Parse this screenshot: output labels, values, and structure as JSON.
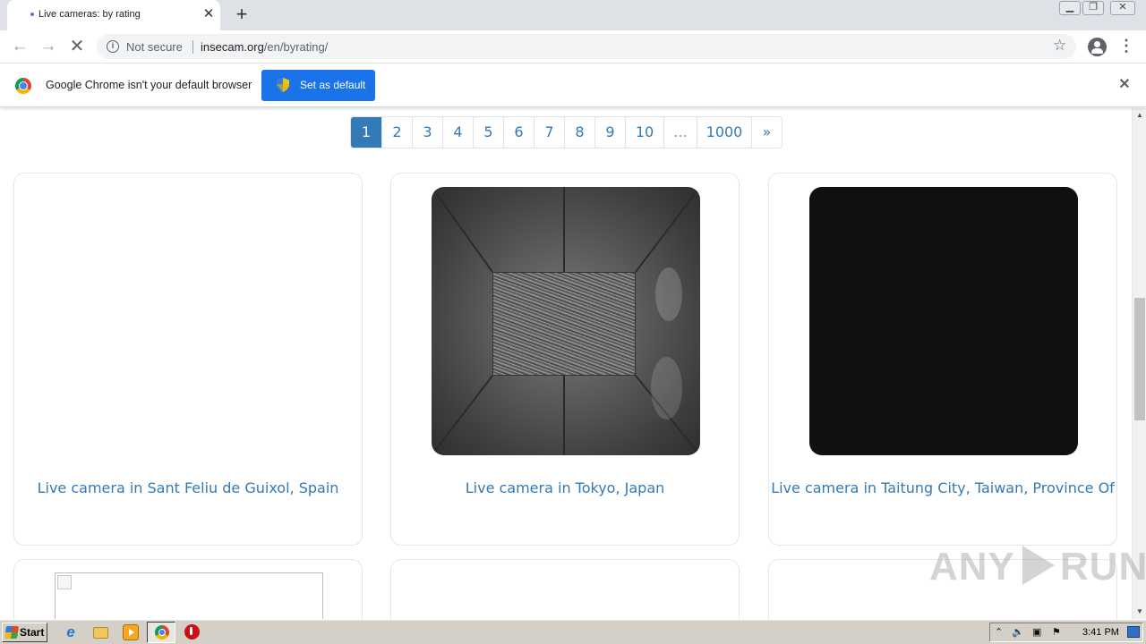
{
  "browser": {
    "tab_title": "Live cameras: by rating",
    "tab_close": "✕",
    "new_tab": "+",
    "security_label": "Not secure",
    "url_host": "insecam.org",
    "url_path": "/en/byrating/"
  },
  "infobar": {
    "message": "Google Chrome isn't your default browser",
    "button_label": "Set as default",
    "close": "✕"
  },
  "pagination": {
    "pages": [
      "1",
      "2",
      "3",
      "4",
      "5",
      "6",
      "7",
      "8",
      "9",
      "10",
      "...",
      "1000",
      "»"
    ],
    "active": "1"
  },
  "cameras": [
    {
      "title": "Live camera in Sant Feliu de Guixol, Spain"
    },
    {
      "title": "Live camera in Tokyo, Japan"
    },
    {
      "title": "Live camera in Taitung City, Taiwan, Province Of"
    }
  ],
  "watermark": {
    "left": "ANY",
    "right": "RUN"
  },
  "taskbar": {
    "start_label": "Start",
    "clock": "3:41 PM"
  },
  "colors": {
    "link": "#337ab7",
    "chrome_blue": "#1a73e8",
    "taskbar": "#d4d0c8"
  }
}
